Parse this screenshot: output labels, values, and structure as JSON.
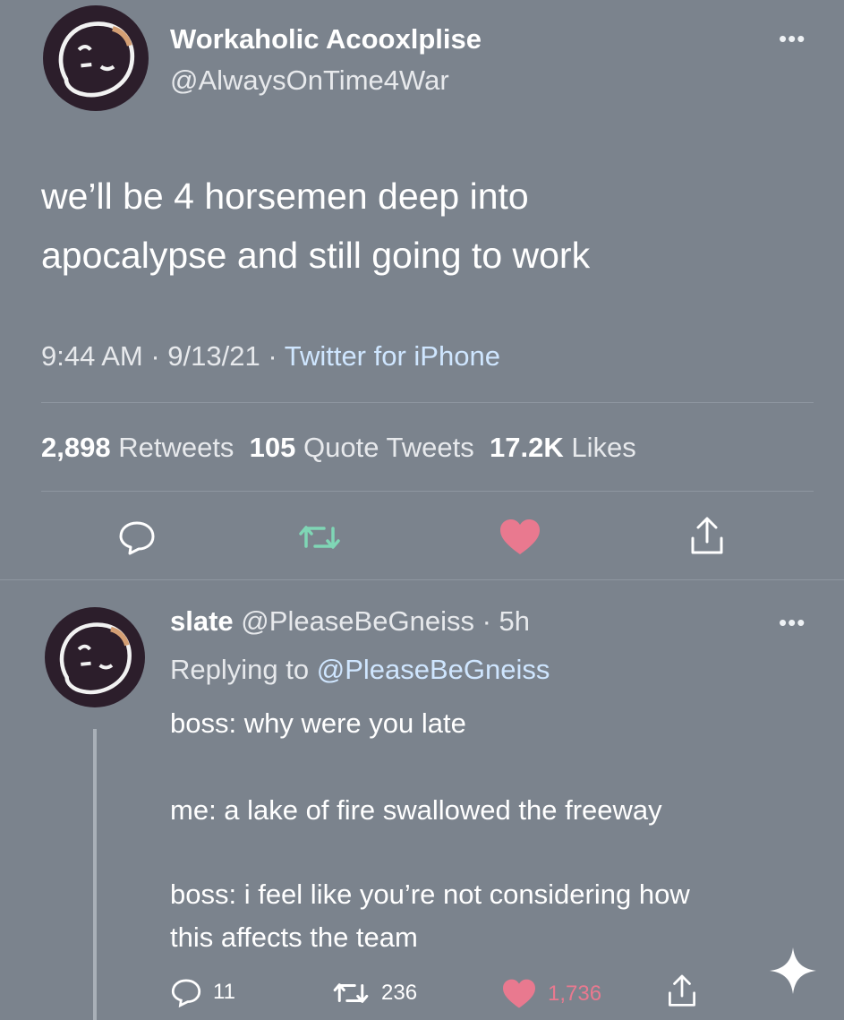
{
  "main_tweet": {
    "display_name": "Workaholic Acooxlplise",
    "handle": "@AlwaysOnTime4War",
    "more": "•••",
    "text_line1": "we’ll be 4 horsemen deep into",
    "text_line2": "apocalypse and still going to work",
    "time": "9:44 AM · 9/13/21 · ",
    "source": "Twitter for iPhone",
    "retweets_count": "2,898",
    "retweets_label": "Retweets",
    "quotes_count": "105",
    "quotes_label": "Quote Tweets",
    "likes_count": "17.2K",
    "likes_label": "Likes",
    "actions": {
      "reply_icon": "reply-icon",
      "retweet_icon": "retweet-icon",
      "like_icon": "heart-icon",
      "share_icon": "share-icon"
    }
  },
  "reply_tweet": {
    "display_name": "slate",
    "handle_time": "@PleaseBeGneiss · 5h",
    "more": "•••",
    "replying_label": "Replying to ",
    "replying_handle": "@PleaseBeGneiss",
    "line1": "boss: why were you late",
    "line2": "me: a lake of fire swallowed the freeway",
    "line3": "boss: i feel like you’re not considering how",
    "line4": "this affects the team",
    "reply_count": "11",
    "retweet_count": "236",
    "like_count": "1,736"
  },
  "colors": {
    "background": "#7b838d",
    "retweet_green": "#7fd6b5",
    "like_pink": "#e9798f",
    "link_blue": "#cfe6ff"
  },
  "fab_icon": "sparkle-icon"
}
